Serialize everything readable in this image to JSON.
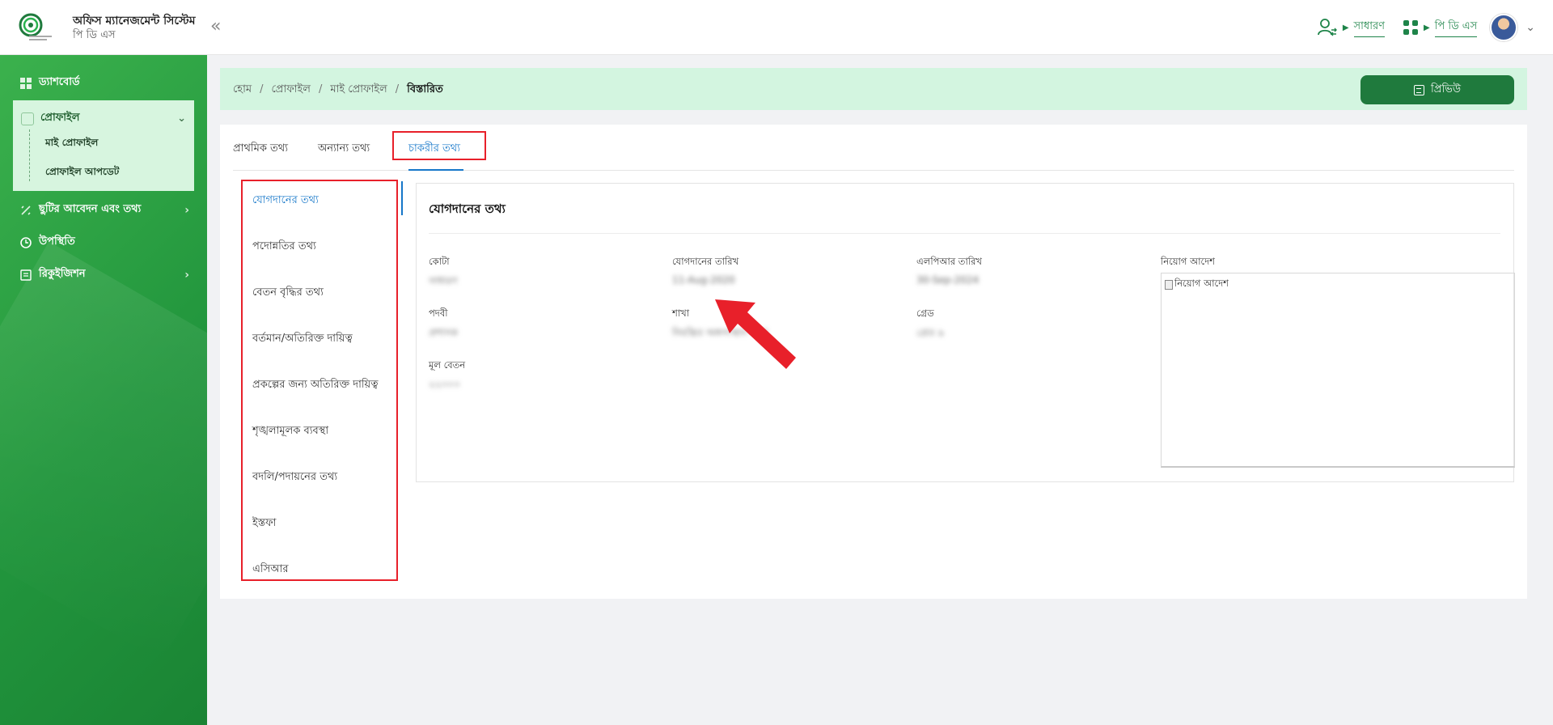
{
  "header": {
    "app_title": "অফিস ম্যানেজমেন্ট সিস্টেম",
    "app_subtitle": "পি ডি এস",
    "role_link": "সাধারণ",
    "module_link": "পি ডি এস"
  },
  "sidebar": {
    "items": [
      {
        "label": "ড্যাশবোর্ড",
        "icon": "dashboard-icon"
      },
      {
        "label": "প্রোফাইল",
        "icon": "profile-icon"
      },
      {
        "label": "ছুটির আবেদন এবং তথ্য",
        "icon": "leave-icon"
      },
      {
        "label": "উপস্থিতি",
        "icon": "clock-icon"
      },
      {
        "label": "রিকুইজিশন",
        "icon": "requisition-icon"
      }
    ],
    "profile_sub": [
      "মাই প্রোফাইল",
      "প্রোফাইল আপডেট"
    ]
  },
  "breadcrumb": {
    "items": [
      "হোম",
      "প্রোফাইল",
      "মাই প্রোফাইল"
    ],
    "current": "বিস্তারিত",
    "preview_label": "প্রিভিউ"
  },
  "tabs": [
    "প্রাথমিক তথ্য",
    "অন্যান্য তথ্য",
    "চাকরীর তথ্য"
  ],
  "vertical_nav": [
    "যোগদানের তথ্য",
    "পদোন্নতির তথ্য",
    "বেতন বৃদ্ধির তথ্য",
    "বর্তমান/অতিরিক্ত দায়িত্ব",
    "প্রকল্পের জন্য অতিরিক্ত দায়িত্ব",
    "শৃঙ্খলামূলক ব্যবস্থা",
    "বদলি/পদায়নের তথ্য",
    "ইস্তফা",
    "এসিআর"
  ],
  "joining": {
    "title": "যোগদানের তথ্য",
    "fields": [
      {
        "label": "কোটা",
        "value": "সাধারণ"
      },
      {
        "label": "যোগদানের তারিখ",
        "value": "11-Aug-2020"
      },
      {
        "label": "এলপিআর তারিখ",
        "value": "30-Sep-2024"
      },
      {
        "label": "পদবী",
        "value": "প্রশাসক"
      },
      {
        "label": "শাখা",
        "value": "নিয়ন্ত্রিত অঙ্গসংস্থান শাখা"
      },
      {
        "label": "গ্রেড",
        "value": "গ্রেড ৯"
      },
      {
        "label": "মূল বেতন",
        "value": "২২০০০"
      }
    ],
    "order_label": "নিয়োগ আদেশ",
    "order_image_alt": "নিয়োগ আদেশ"
  },
  "colors": {
    "brand_green": "#1f7a3d",
    "active_blue": "#1677c9",
    "highlight_red": "#e8202a"
  }
}
